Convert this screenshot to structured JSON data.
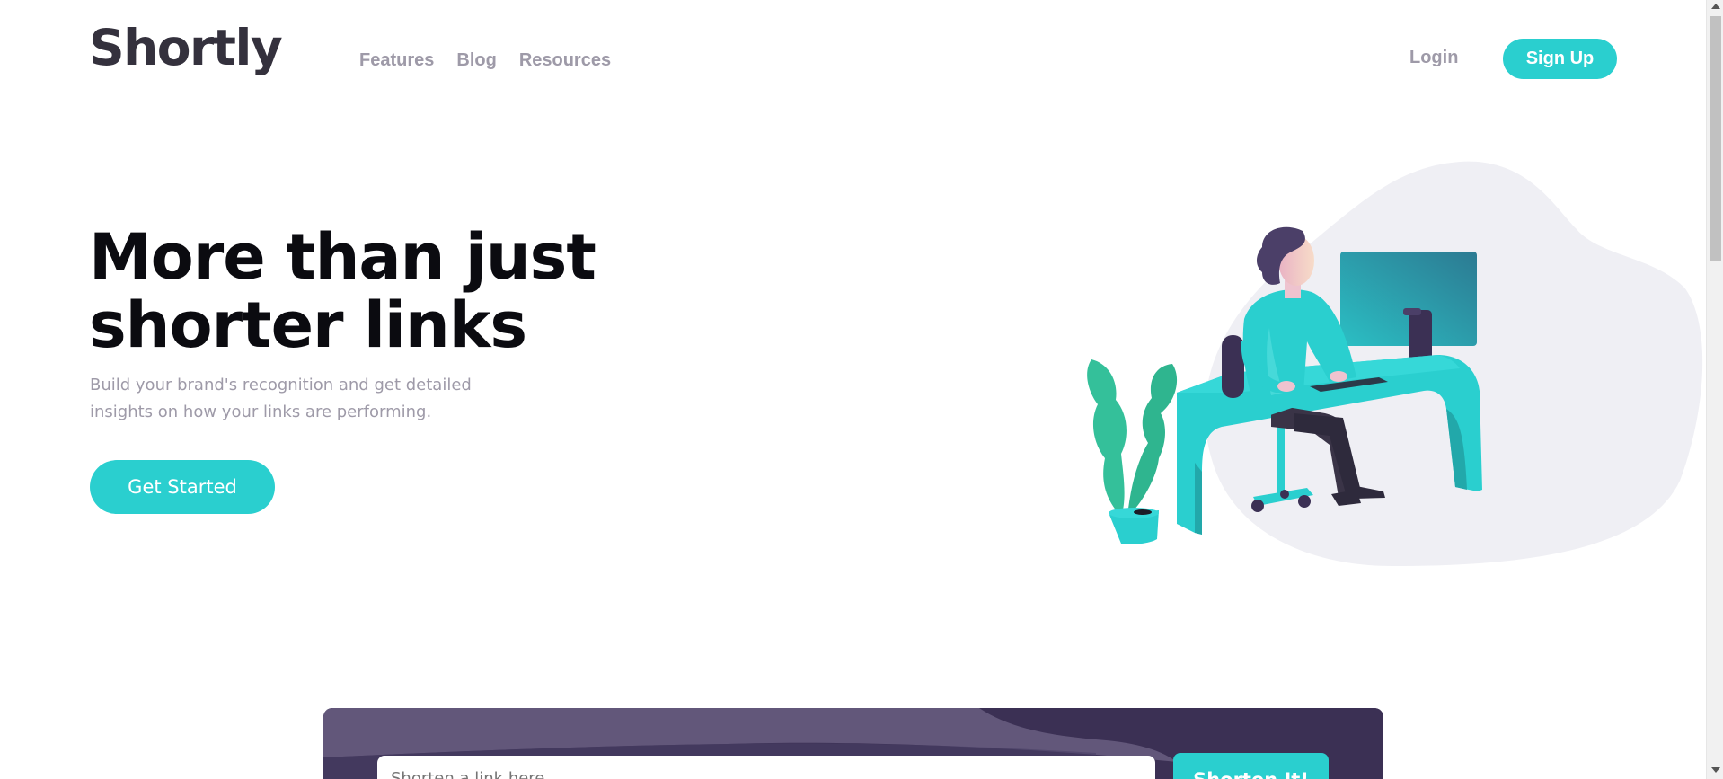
{
  "brand": {
    "name": "Shortly"
  },
  "nav": {
    "items": [
      "Features",
      "Blog",
      "Resources"
    ],
    "login": "Login",
    "signup": "Sign Up"
  },
  "hero": {
    "title_line1": "More than just",
    "title_line2": "shorter links",
    "subtitle_line1": "Build your brand's recognition and get detailed",
    "subtitle_line2": "insights on how your links are performing.",
    "cta": "Get Started"
  },
  "shorten": {
    "placeholder": "Shorten a link here...",
    "button": "Shorten It!"
  },
  "colors": {
    "cyan": "#2acfcf",
    "dark_violet": "#3b3054",
    "grayish_violet": "#9e9aa8",
    "very_dark_blue": "#34313d"
  }
}
